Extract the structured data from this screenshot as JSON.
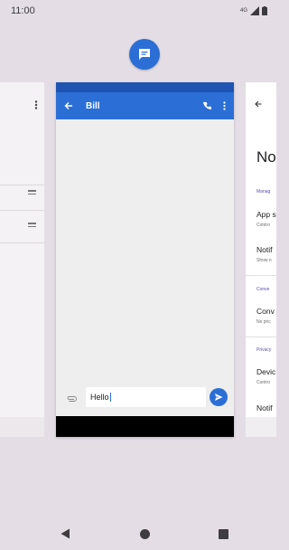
{
  "status_bar": {
    "time": "11:00",
    "network_label": "4G",
    "icons": [
      "network-type-icon",
      "cell-signal-icon",
      "battery-icon"
    ]
  },
  "recents": {
    "app_icon": "messages-app-icon",
    "center_card": {
      "contact_name": "Bill",
      "compose": {
        "value": "Hello",
        "icons": [
          "attach-icon",
          "send-icon"
        ]
      },
      "toolbar_icons": [
        "back-arrow-icon",
        "phone-icon",
        "more-vert-icon"
      ]
    },
    "right_card": {
      "title": "No",
      "sections": [
        {
          "label": "Manag"
        },
        {
          "label": "Conve"
        },
        {
          "label": "Privacy"
        }
      ],
      "items": [
        {
          "title": "App s",
          "sub": "Contro"
        },
        {
          "title": "Notif",
          "sub": "Show n"
        },
        {
          "title": "Conv",
          "sub": "No pric"
        },
        {
          "title": "Devic",
          "sub": "Contro"
        },
        {
          "title": "Notif",
          "sub": ""
        }
      ]
    }
  },
  "nav": {
    "icons": [
      "nav-back-icon",
      "nav-home-icon",
      "nav-recents-icon"
    ]
  },
  "colors": {
    "background": "#e4dde6",
    "app_blue": "#2b6fd6",
    "app_blue_dark": "#1f54b3",
    "accent_purple": "#5c4fa8"
  }
}
